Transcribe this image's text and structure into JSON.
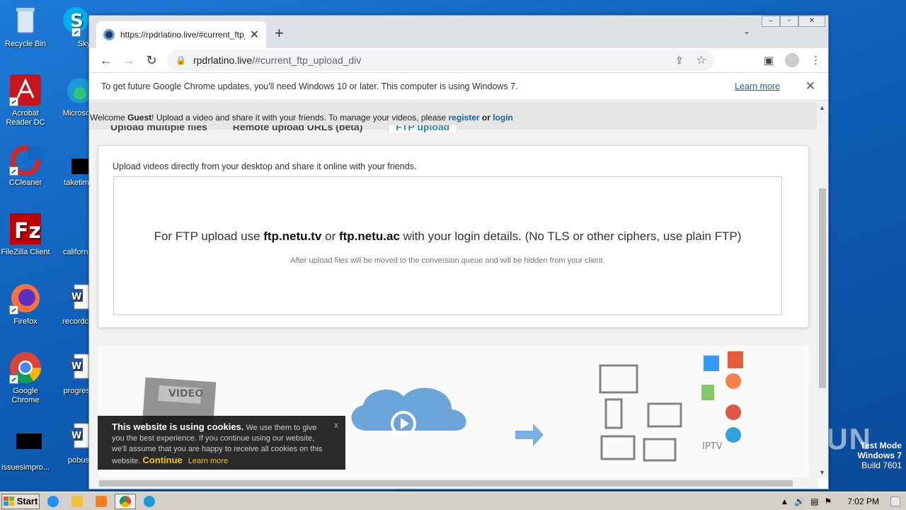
{
  "desktop": {
    "icons": [
      {
        "label": "Recycle Bin",
        "icon": "recycle-bin-icon"
      },
      {
        "label": "Skype",
        "icon": "skype-icon"
      },
      {
        "label": "Acrobat Reader DC",
        "icon": "acrobat-icon"
      },
      {
        "label": "Microsoft",
        "icon": "edge-icon"
      },
      {
        "label": "CCleaner",
        "icon": "ccleaner-icon"
      },
      {
        "label": "taketime",
        "icon": "blank-file-icon"
      },
      {
        "label": "FileZilla Client",
        "icon": "filezilla-icon"
      },
      {
        "label": "california",
        "icon": "blank-file-icon"
      },
      {
        "label": "Firefox",
        "icon": "firefox-icon"
      },
      {
        "label": "recordclo",
        "icon": "word-doc-icon"
      },
      {
        "label": "Google Chrome",
        "icon": "chrome-icon"
      },
      {
        "label": "progress",
        "icon": "word-doc-icon"
      },
      {
        "label": "issuesimpro...",
        "icon": "blank-file-icon"
      },
      {
        "label": "pobus",
        "icon": "word-doc-icon"
      }
    ]
  },
  "browser": {
    "tab_title": "https://rpdrlatino.live/#current_ftp_",
    "url_host": "rpdrlatino.live",
    "url_path": "/#current_ftp_upload_div",
    "infobar_text": "To get future Google Chrome updates, you'll need Windows 10 or later. This computer is using Windows 7.",
    "infobar_link": "Learn more"
  },
  "page": {
    "welcome_prefix": "Welcome ",
    "welcome_guest": "Guest",
    "welcome_mid": "! Upload a video and share it with your friends. To manage your videos, please ",
    "register": "register",
    "or": " or ",
    "login": "login",
    "tabs": [
      "Upload multiple files",
      "Remote upload URLs (beta)",
      "FTP upload"
    ],
    "intro": "Upload videos directly from your desktop and share it online with your friends.",
    "ftp_prefix": "For FTP upload use ",
    "ftp_host1": "ftp.netu.tv",
    "ftp_or": " or ",
    "ftp_host2": "ftp.netu.ac",
    "ftp_suffix": " with your login details. (No TLS or other ciphers, use plain FTP)",
    "ftp_note": "After upload files will be moved to the conversion queue and will be hidden from your client.",
    "illus_video_label": "VIDEO",
    "illus_iptv": "IPTV"
  },
  "cookie": {
    "heading": "This website is using cookies.",
    "body": " We use them to give you the best experience. If you continue using our website, we'll assume that you are happy to receive all cookies on this website.",
    "continue": "Continue",
    "learn_more": "Learn more",
    "close": "x"
  },
  "taskbar": {
    "start": "Start",
    "clock": "7:02 PM"
  },
  "watermark": {
    "line1": "Test Mode",
    "line2": "Windows 7",
    "line3": "Build 7601",
    "brand": "ANY RUN"
  }
}
